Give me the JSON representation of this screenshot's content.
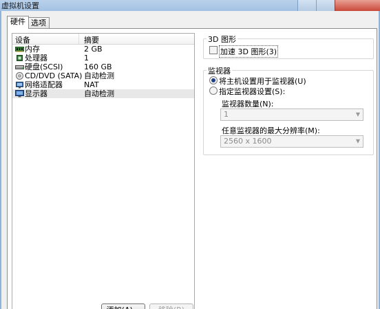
{
  "window": {
    "title": "虚拟机设置"
  },
  "tabs": [
    {
      "label": "硬件"
    },
    {
      "label": "选项"
    }
  ],
  "device_list": {
    "columns": {
      "device": "设备",
      "summary": "摘要"
    },
    "rows": [
      {
        "device": "内存",
        "summary": "2 GB",
        "icon": "memory-icon"
      },
      {
        "device": "处理器",
        "summary": "1",
        "icon": "processor-icon"
      },
      {
        "device": "硬盘(SCSI)",
        "summary": "160 GB",
        "icon": "harddisk-icon"
      },
      {
        "device": "CD/DVD (SATA)",
        "summary": "自动检测",
        "icon": "cd-dvd-icon"
      },
      {
        "device": "网络适配器",
        "summary": "NAT",
        "icon": "network-adapter-icon"
      },
      {
        "device": "显示器",
        "summary": "自动检测",
        "icon": "display-icon"
      }
    ],
    "selected_index": 5
  },
  "graphics_3d": {
    "group_label": "3D 图形",
    "accelerate_label": "加速 3D 图形(3)",
    "accelerate_checked": false
  },
  "monitors": {
    "group_label": "监视器",
    "option_host": "将主机设置用于监视器(U)",
    "option_specify": "指定监视器设置(S):",
    "selected_option": "host",
    "count_label": "监视器数量(N):",
    "count_value": "1",
    "max_res_label": "任意监视器的最大分辨率(M):",
    "max_res_value": "2560 x 1600"
  },
  "buttons": {
    "add": "添加(A)...",
    "remove": "移除(R)"
  }
}
